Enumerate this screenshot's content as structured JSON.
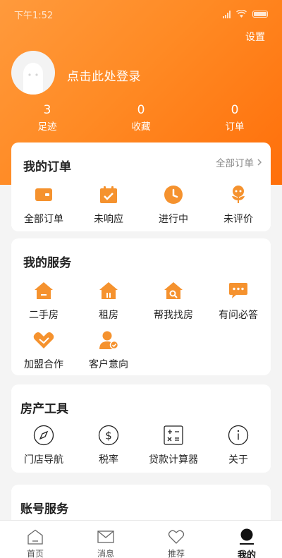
{
  "status_bar": {
    "time": "下午1:52"
  },
  "header": {
    "settings_label": "设置",
    "login_prompt": "点击此处登录",
    "stats": [
      {
        "value": "3",
        "label": "足迹"
      },
      {
        "value": "0",
        "label": "收藏"
      },
      {
        "value": "0",
        "label": "订单"
      }
    ]
  },
  "orders": {
    "title": "我的订单",
    "all_link": "全部订单",
    "items": [
      {
        "label": "全部订单",
        "icon": "wallet-icon"
      },
      {
        "label": "未响应",
        "icon": "calendar-check-icon"
      },
      {
        "label": "进行中",
        "icon": "clock-icon"
      },
      {
        "label": "未评价",
        "icon": "flower-icon"
      }
    ]
  },
  "services": {
    "title": "我的服务",
    "items": [
      {
        "label": "二手房",
        "icon": "house-icon"
      },
      {
        "label": "租房",
        "icon": "rent-house-icon"
      },
      {
        "label": "帮我找房",
        "icon": "house-search-icon"
      },
      {
        "label": "有问必答",
        "icon": "chat-icon"
      },
      {
        "label": "加盟合作",
        "icon": "handshake-icon"
      },
      {
        "label": "客户意向",
        "icon": "customer-icon"
      }
    ]
  },
  "tools": {
    "title": "房产工具",
    "items": [
      {
        "label": "门店导航",
        "icon": "compass-icon"
      },
      {
        "label": "税率",
        "icon": "dollar-icon"
      },
      {
        "label": "贷款计算器",
        "icon": "calculator-icon"
      },
      {
        "label": "关于",
        "icon": "info-icon"
      }
    ]
  },
  "account": {
    "title": "账号服务"
  },
  "tabbar": [
    {
      "label": "首页",
      "icon": "home-icon"
    },
    {
      "label": "消息",
      "icon": "mail-icon"
    },
    {
      "label": "推荐",
      "icon": "heart-icon"
    },
    {
      "label": "我的",
      "icon": "profile-icon",
      "active": true
    }
  ],
  "colors": {
    "accent": "#ff8a24",
    "icon_orange": "#f5922e"
  }
}
